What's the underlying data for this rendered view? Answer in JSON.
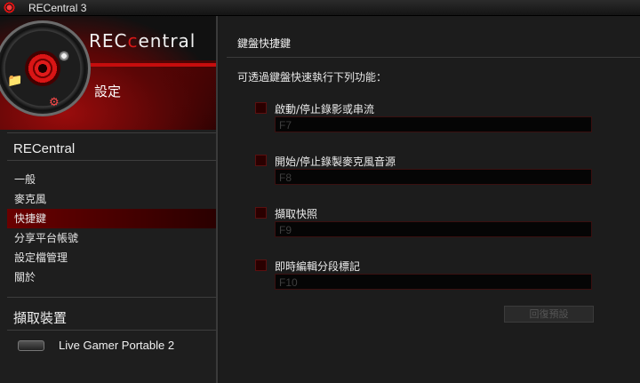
{
  "window": {
    "title": "RECentral 3"
  },
  "banner": {
    "logo_prefix": "REC",
    "logo_suffix": "entral",
    "logo_highlight": "c",
    "settings_title": "設定"
  },
  "sidebar": {
    "section_title": "RECentral",
    "items": [
      {
        "label": "一般",
        "active": false
      },
      {
        "label": "麥克風",
        "active": false
      },
      {
        "label": "快捷鍵",
        "active": true
      },
      {
        "label": "分享平台帳號",
        "active": false
      },
      {
        "label": "設定檔管理",
        "active": false
      },
      {
        "label": "關於",
        "active": false
      }
    ],
    "capture_section_title": "擷取裝置",
    "device": {
      "name": "Live Gamer Portable 2",
      "icon": "capture-device-icon"
    }
  },
  "main": {
    "title": "鍵盤快捷鍵",
    "description": "可透過鍵盤快速執行下列功能：",
    "hotkeys": [
      {
        "label": "啟動/停止錄影或串流",
        "key": "F7",
        "checked": false
      },
      {
        "label": "開始/停止錄製麥克風音源",
        "key": "F8",
        "checked": false
      },
      {
        "label": "擷取快照",
        "key": "F9",
        "checked": false
      },
      {
        "label": "即時編輯分段標記",
        "key": "F10",
        "checked": false
      }
    ],
    "restore_button": "回復預設"
  },
  "colors": {
    "accent": "#d81818",
    "background": "#1c1c1c",
    "active_item": "#6a0000"
  }
}
